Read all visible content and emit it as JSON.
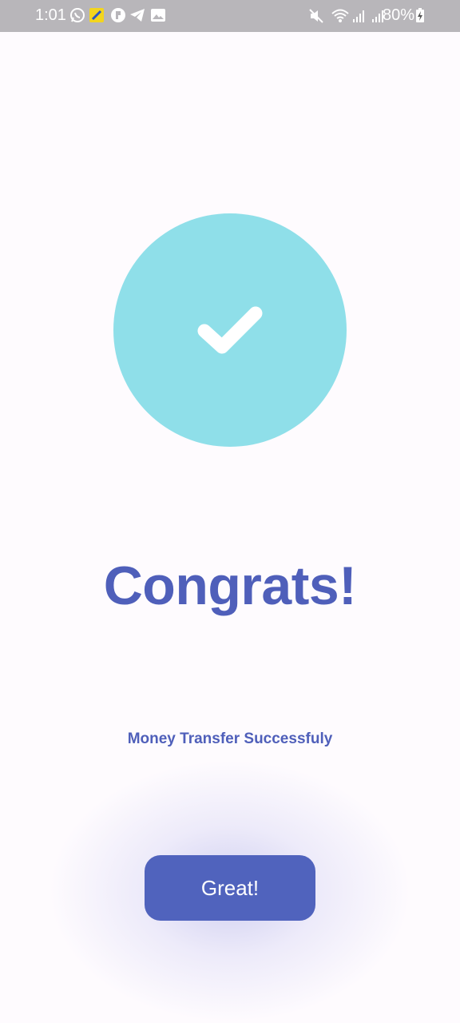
{
  "status_bar": {
    "time": "1:01",
    "battery": "80%",
    "left_icons": [
      "whatsapp-icon",
      "app-icon",
      "pinterest-icon",
      "telegram-icon",
      "gallery-icon"
    ],
    "right_icons": [
      "mute-icon",
      "wifi-icon",
      "signal-icon",
      "signal-icon",
      "battery-charging-icon"
    ]
  },
  "success": {
    "icon": "check-icon",
    "circle_color": "#8fdfe9",
    "title": "Congrats!",
    "message": "Money Transfer Successfuly"
  },
  "actions": {
    "confirm_label": "Great!"
  },
  "colors": {
    "accent": "#5063bd",
    "background": "#fefbfe",
    "status_bar": "#b8b6ba"
  }
}
